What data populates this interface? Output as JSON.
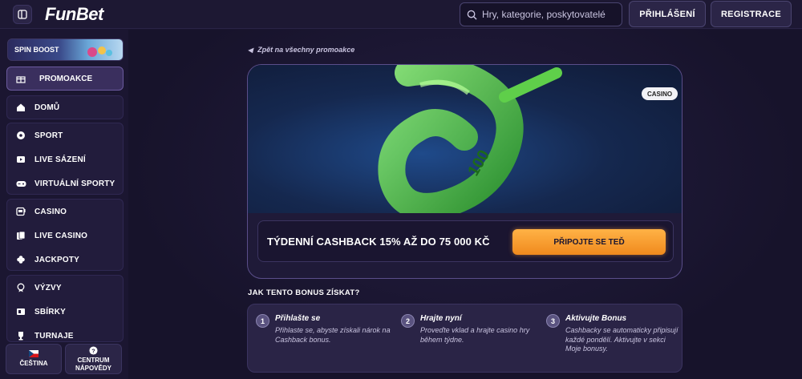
{
  "header": {
    "logo": "FunBet",
    "search_placeholder": "Hry, kategorie, poskytovatelé",
    "login_label": "PŘIHLÁŠENÍ",
    "register_label": "REGISTRACE"
  },
  "sidebar": {
    "spin_boost": "SPIN BOOST",
    "promo": "PROMOAKCE",
    "home": "DOMŮ",
    "sport_items": [
      "SPORT",
      "LIVE SÁZENÍ",
      "VIRTUÁLNÍ SPORTY"
    ],
    "casino_items": [
      "CASINO",
      "LIVE CASINO",
      "JACKPOTY"
    ],
    "other_items": [
      "VÝZVY",
      "SBÍRKY",
      "TURNAJE"
    ],
    "language": "ČEŠTINA",
    "help_center": "CENTRUM NÁPOVĚDY"
  },
  "main": {
    "back_link": "Zpět na všechny promoakce",
    "casino_tag": "CASINO",
    "offer_title": "TÝDENNÍ CASHBACK 15% AŽ DO 75 000 KČ",
    "cta_label": "PŘIPOJTE SE TEĎ",
    "how_title": "JAK TENTO BONUS ZÍSKAT?",
    "steps": [
      {
        "num": "1",
        "title": "Přihlašte se",
        "desc": "Přihlaste se, abyste získali nárok na Cashback bonus."
      },
      {
        "num": "2",
        "title": "Hrajte nyní",
        "desc": "Proveďte vklad a hrajte casino hry během týdne."
      },
      {
        "num": "3",
        "title": "Aktivujte Bonus",
        "desc": "Cashbacky se automaticky připisují každé pondělí. Aktivujte v sekci Moje bonusy."
      }
    ]
  },
  "colors": {
    "background": "#1a1530",
    "accent_orange": "#f08a1d",
    "sidebar_active": "#3a2f5e"
  }
}
